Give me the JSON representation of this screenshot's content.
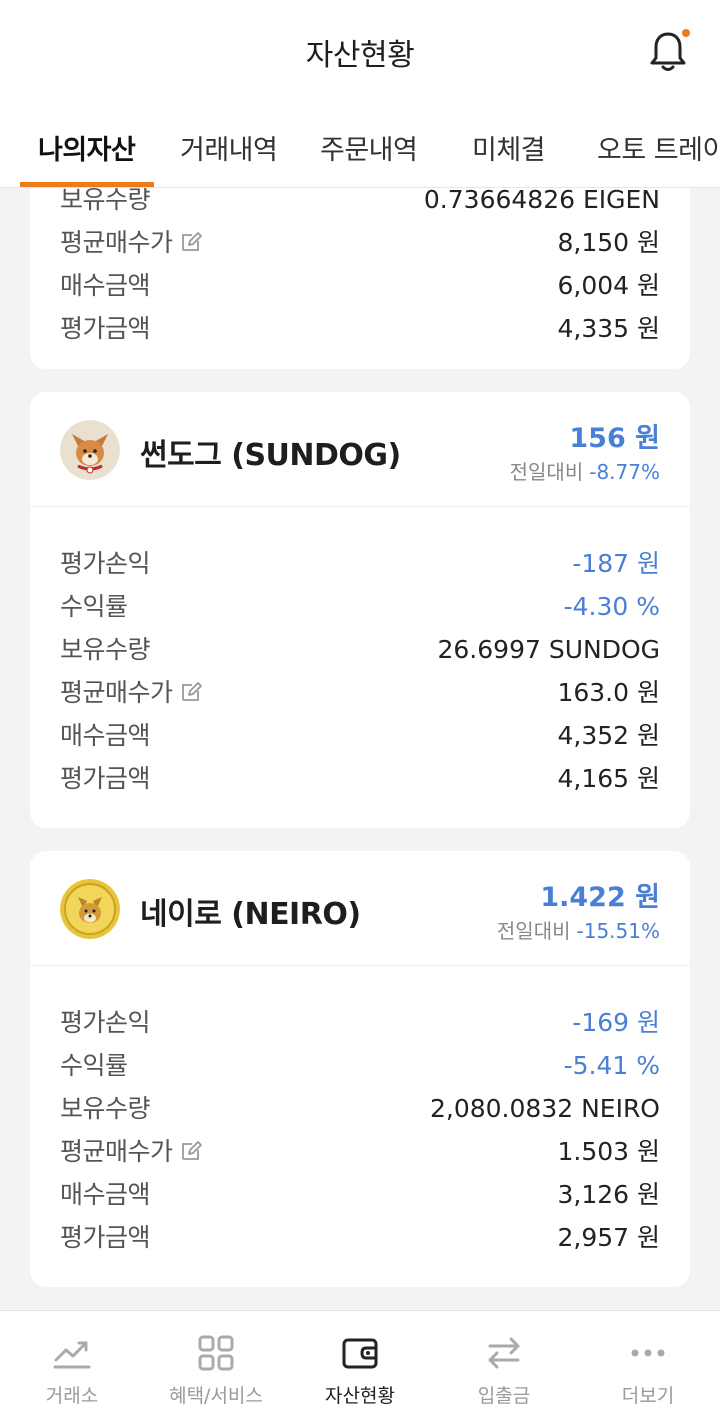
{
  "header": {
    "title": "자산현황"
  },
  "tabs": [
    {
      "label": "나의자산",
      "active": true
    },
    {
      "label": "거래내역"
    },
    {
      "label": "주문내역"
    },
    {
      "label": "미체결"
    },
    {
      "label": "오토 트레이"
    }
  ],
  "partial_card": {
    "rows": [
      {
        "label": "보유수량",
        "value": "0.73664826 EIGEN"
      },
      {
        "label": "평균매수가",
        "value": "8,150 원",
        "editable": true
      },
      {
        "label": "매수금액",
        "value": "6,004 원"
      },
      {
        "label": "평가금액",
        "value": "4,335 원"
      }
    ]
  },
  "coins": [
    {
      "name": "썬도그 (SUNDOG)",
      "price": "156 원",
      "change_label": "전일대비",
      "change_pct": "-8.77%",
      "rows": [
        {
          "label": "평가손익",
          "value": "-187 원",
          "blue": true
        },
        {
          "label": "수익률",
          "value": "-4.30 %",
          "blue": true
        },
        {
          "label": "보유수량",
          "value": "26.6997 SUNDOG"
        },
        {
          "label": "평균매수가",
          "value": "163.0 원",
          "editable": true
        },
        {
          "label": "매수금액",
          "value": "4,352 원"
        },
        {
          "label": "평가금액",
          "value": "4,165 원"
        }
      ]
    },
    {
      "name": "네이로 (NEIRO)",
      "price": "1.422 원",
      "change_label": "전일대비",
      "change_pct": "-15.51%",
      "rows": [
        {
          "label": "평가손익",
          "value": "-169 원",
          "blue": true
        },
        {
          "label": "수익률",
          "value": "-5.41 %",
          "blue": true
        },
        {
          "label": "보유수량",
          "value": "2,080.0832 NEIRO"
        },
        {
          "label": "평균매수가",
          "value": "1.503 원",
          "editable": true
        },
        {
          "label": "매수금액",
          "value": "3,126 원"
        },
        {
          "label": "평가금액",
          "value": "2,957 원"
        }
      ]
    }
  ],
  "bottom_nav": [
    {
      "label": "거래소",
      "icon": "chart-icon"
    },
    {
      "label": "혜택/서비스",
      "icon": "grid-icon"
    },
    {
      "label": "자산현황",
      "icon": "wallet-icon",
      "active": true
    },
    {
      "label": "입출금",
      "icon": "transfer-icon"
    },
    {
      "label": "더보기",
      "icon": "more-icon"
    }
  ],
  "colors": {
    "accent": "#f07a1a",
    "negative": "#4a7fd6"
  }
}
